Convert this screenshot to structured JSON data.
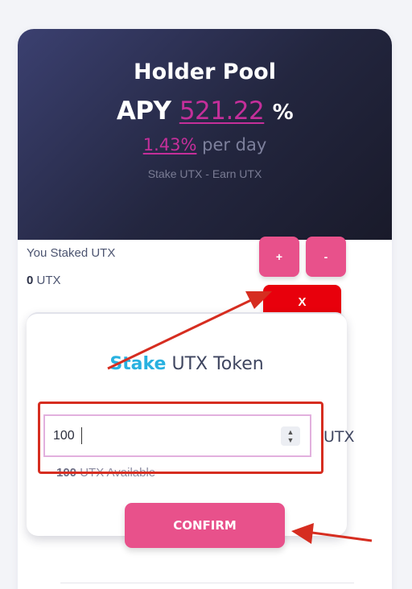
{
  "pool": {
    "title": "Holder Pool",
    "apy_label": "APY",
    "apy_value": "521.22",
    "apy_suffix": "%",
    "daily_value": "1.43%",
    "daily_suffix": "per day",
    "subtitle": "Stake UTX - Earn UTX"
  },
  "staked": {
    "label": "You Staked UTX",
    "amount": "0",
    "unit": "UTX"
  },
  "buttons": {
    "plus": "+",
    "minus": "-",
    "close": "X",
    "confirm": "CONFIRM"
  },
  "stake_form": {
    "title_highlight": "Stake",
    "title_rest": "UTX Token",
    "amount_value": "100",
    "unit": "UTX",
    "available_amount": "100",
    "available_suffix": "UTX Available"
  },
  "colors": {
    "accent_pink": "#e8518b",
    "apy_magenta": "#c42f9a",
    "stake_blue": "#28b1e0",
    "close_red": "#e8000c",
    "annotation_red": "#d62d20",
    "hero_dark": "#23263f"
  },
  "icons": {
    "spinner": "number-spinner-icon",
    "arrow_up": "annotation-arrow-icon",
    "arrow_left": "annotation-arrow-icon"
  }
}
